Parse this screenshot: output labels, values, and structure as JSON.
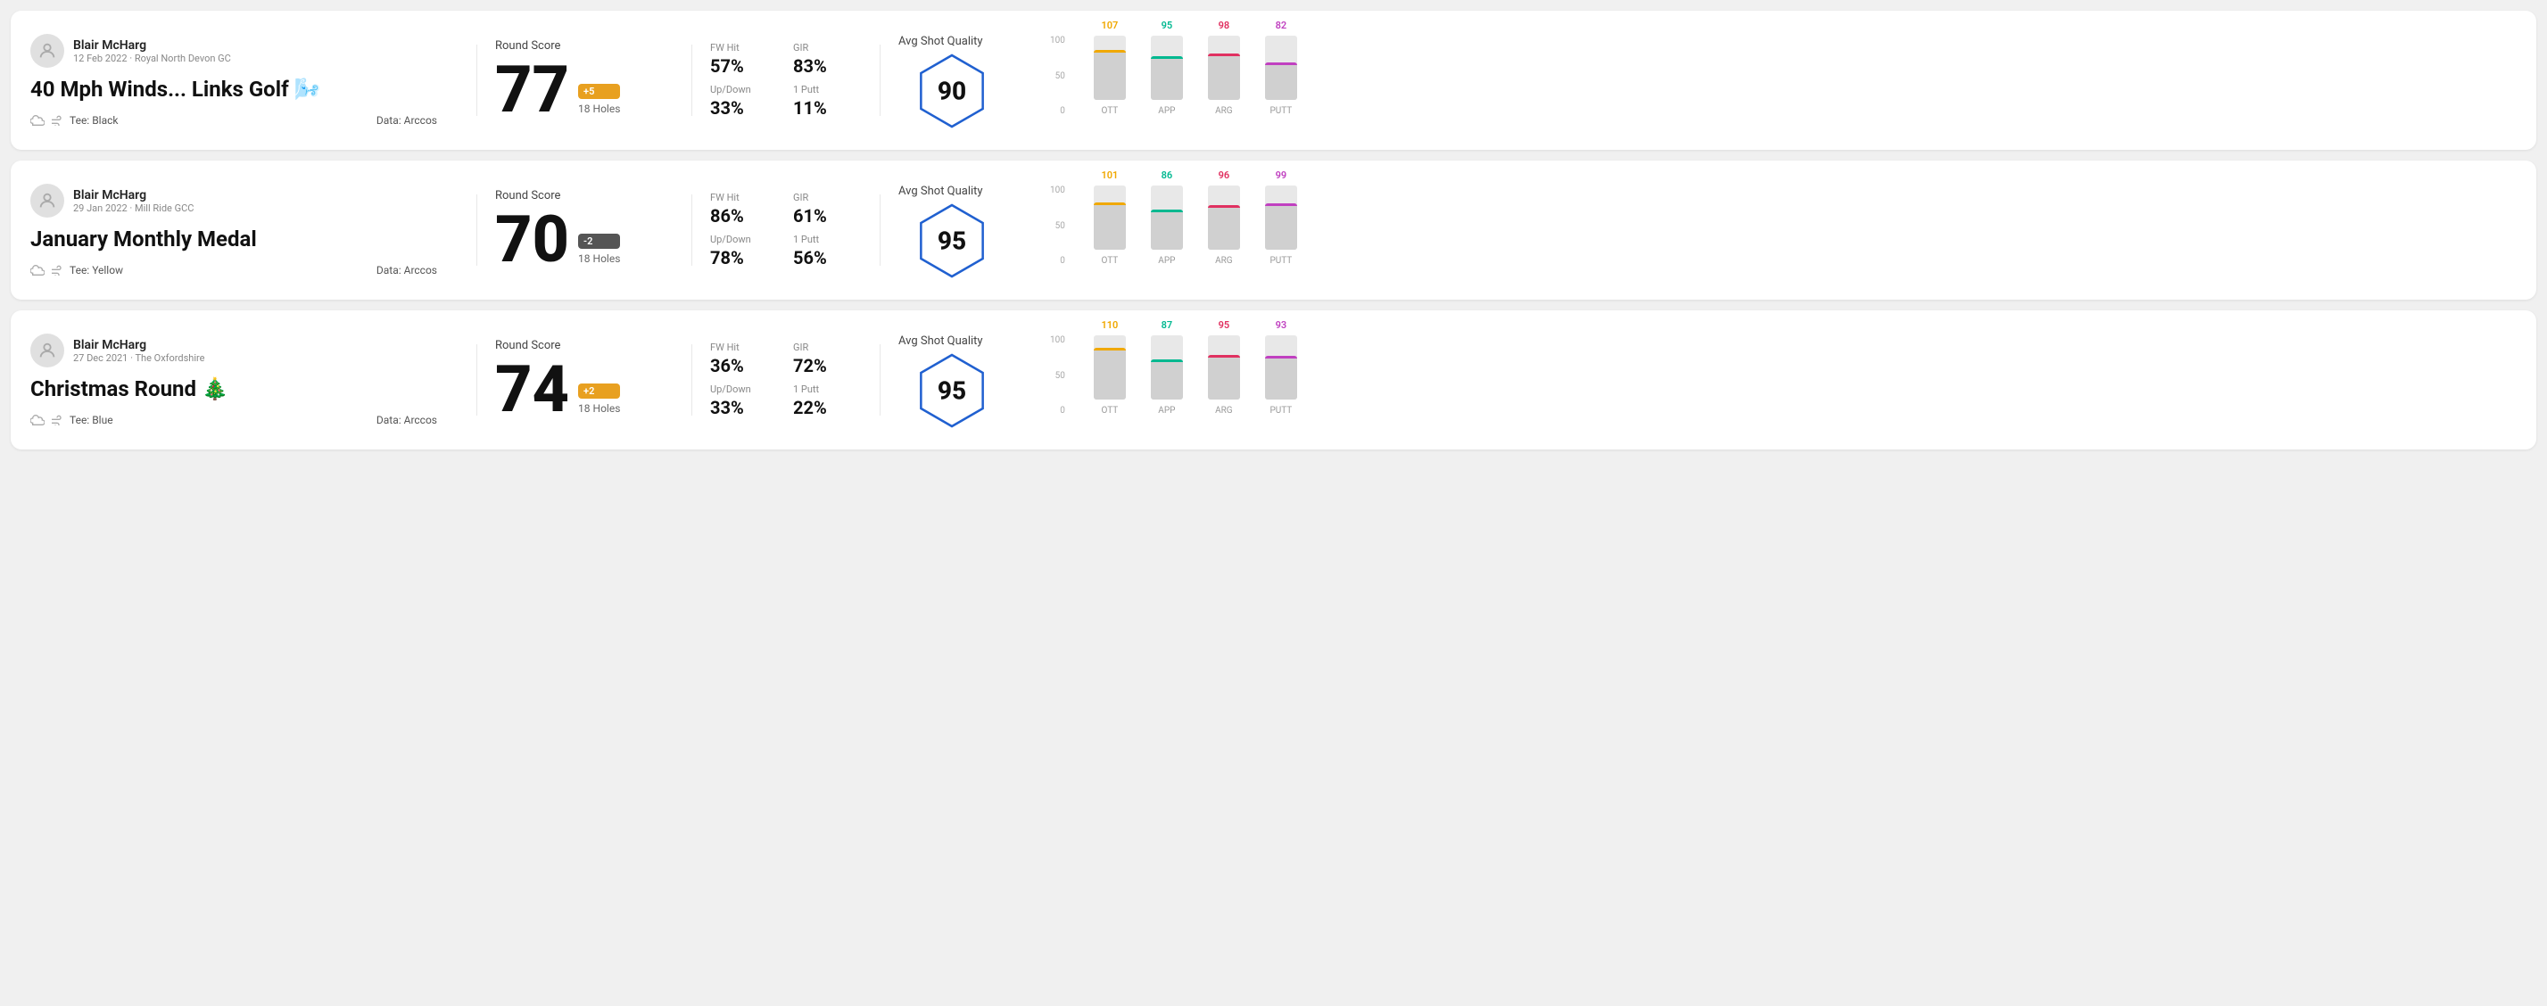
{
  "rounds": [
    {
      "id": "round1",
      "user": {
        "name": "Blair McHarg",
        "meta": "12 Feb 2022 · Royal North Devon GC"
      },
      "title": "40 Mph Winds... Links Golf 🌬️",
      "tee": "Black",
      "data_source": "Arccos",
      "score": {
        "label": "Round Score",
        "number": "77",
        "badge": "+5",
        "badge_type": "positive",
        "holes": "18 Holes"
      },
      "stats": [
        {
          "label": "FW Hit",
          "value": "57%"
        },
        {
          "label": "GIR",
          "value": "83%"
        },
        {
          "label": "Up/Down",
          "value": "33%"
        },
        {
          "label": "1 Putt",
          "value": "11%"
        }
      ],
      "quality": {
        "label": "Avg Shot Quality",
        "value": "90"
      },
      "chart": {
        "bars": [
          {
            "category": "OTT",
            "value": 107,
            "color": "#f0a800",
            "pct": 78
          },
          {
            "category": "APP",
            "value": 95,
            "color": "#00b890",
            "pct": 68
          },
          {
            "category": "ARG",
            "value": 98,
            "color": "#e03060",
            "pct": 72
          },
          {
            "category": "PUTT",
            "value": 82,
            "color": "#c040c0",
            "pct": 58
          }
        ],
        "y_labels": [
          "100",
          "50",
          "0"
        ]
      }
    },
    {
      "id": "round2",
      "user": {
        "name": "Blair McHarg",
        "meta": "29 Jan 2022 · Mill Ride GCC"
      },
      "title": "January Monthly Medal",
      "tee": "Yellow",
      "data_source": "Arccos",
      "score": {
        "label": "Round Score",
        "number": "70",
        "badge": "-2",
        "badge_type": "negative",
        "holes": "18 Holes"
      },
      "stats": [
        {
          "label": "FW Hit",
          "value": "86%"
        },
        {
          "label": "GIR",
          "value": "61%"
        },
        {
          "label": "Up/Down",
          "value": "78%"
        },
        {
          "label": "1 Putt",
          "value": "56%"
        }
      ],
      "quality": {
        "label": "Avg Shot Quality",
        "value": "95"
      },
      "chart": {
        "bars": [
          {
            "category": "OTT",
            "value": 101,
            "color": "#f0a800",
            "pct": 74
          },
          {
            "category": "APP",
            "value": 86,
            "color": "#00b890",
            "pct": 62
          },
          {
            "category": "ARG",
            "value": 96,
            "color": "#e03060",
            "pct": 70
          },
          {
            "category": "PUTT",
            "value": 99,
            "color": "#c040c0",
            "pct": 72
          }
        ],
        "y_labels": [
          "100",
          "50",
          "0"
        ]
      }
    },
    {
      "id": "round3",
      "user": {
        "name": "Blair McHarg",
        "meta": "27 Dec 2021 · The Oxfordshire"
      },
      "title": "Christmas Round 🎄",
      "tee": "Blue",
      "data_source": "Arccos",
      "score": {
        "label": "Round Score",
        "number": "74",
        "badge": "+2",
        "badge_type": "positive",
        "holes": "18 Holes"
      },
      "stats": [
        {
          "label": "FW Hit",
          "value": "36%"
        },
        {
          "label": "GIR",
          "value": "72%"
        },
        {
          "label": "Up/Down",
          "value": "33%"
        },
        {
          "label": "1 Putt",
          "value": "22%"
        }
      ],
      "quality": {
        "label": "Avg Shot Quality",
        "value": "95"
      },
      "chart": {
        "bars": [
          {
            "category": "OTT",
            "value": 110,
            "color": "#f0a800",
            "pct": 80
          },
          {
            "category": "APP",
            "value": 87,
            "color": "#00b890",
            "pct": 63
          },
          {
            "category": "ARG",
            "value": 95,
            "color": "#e03060",
            "pct": 69
          },
          {
            "category": "PUTT",
            "value": 93,
            "color": "#c040c0",
            "pct": 68
          }
        ],
        "y_labels": [
          "100",
          "50",
          "0"
        ]
      }
    }
  ]
}
